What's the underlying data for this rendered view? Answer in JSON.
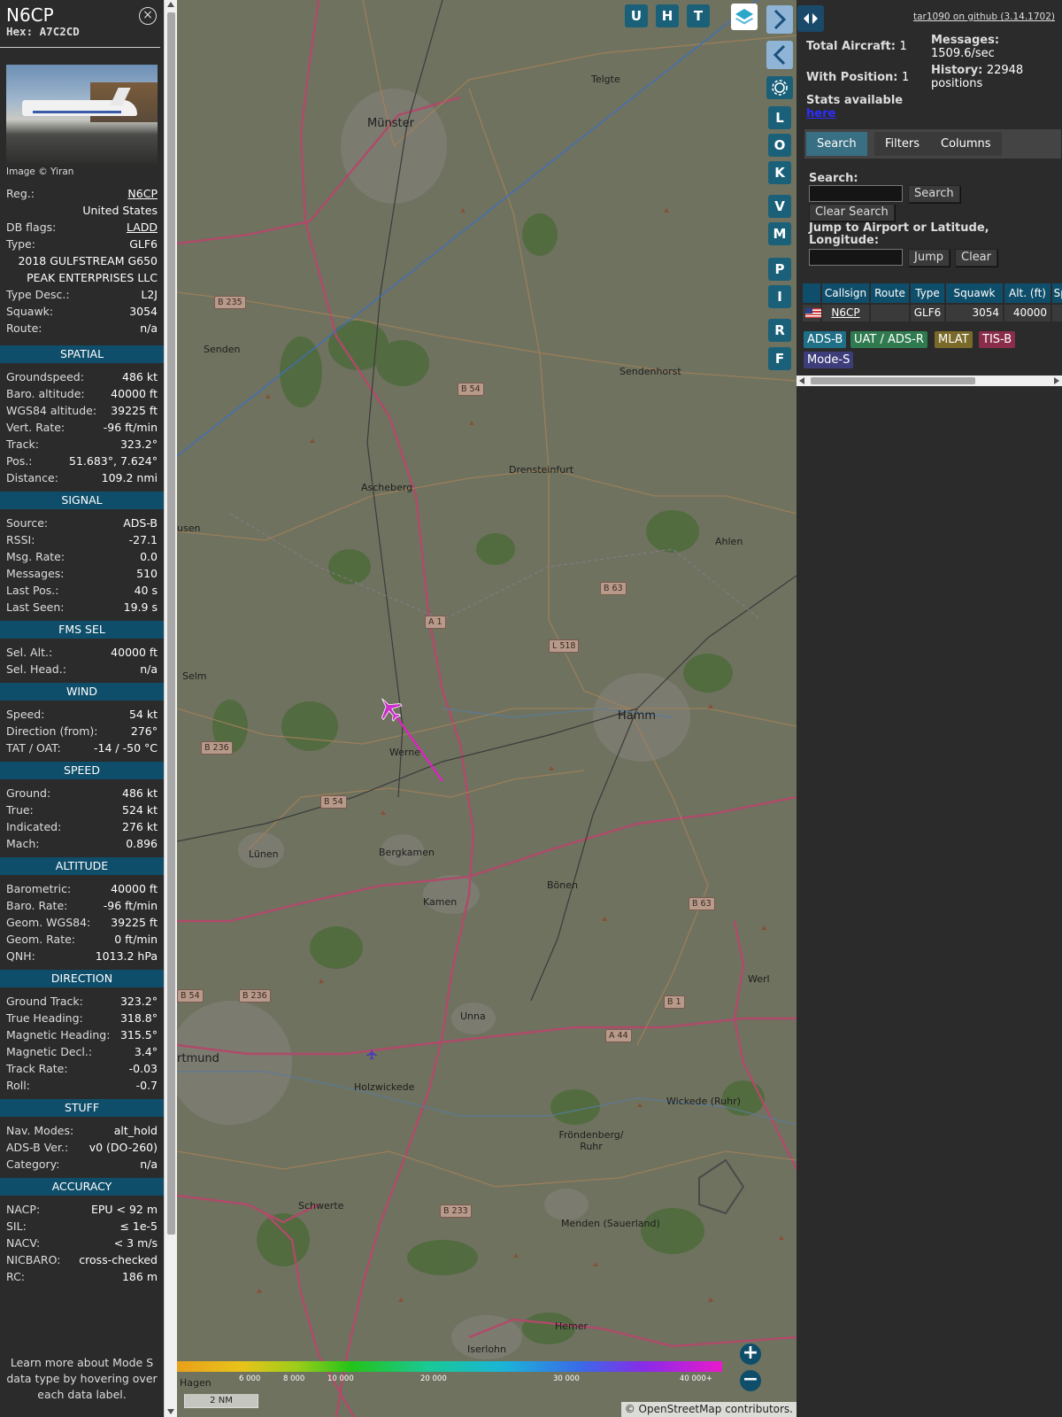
{
  "info": {
    "callsign": "N6CP",
    "hex_label": "Hex:",
    "hex": "A7C2CD",
    "close_icon": "close-circle-icon",
    "photo_credit": "Image © Yiran",
    "general": [
      {
        "label": "Reg.:",
        "value": "N6CP",
        "link": true
      },
      {
        "label": "",
        "value": "United States"
      },
      {
        "label": "DB flags:",
        "value": "LADD",
        "link": true
      },
      {
        "label": "Type:",
        "value": "GLF6"
      },
      {
        "label": "",
        "value": "2018 GULFSTREAM G650"
      },
      {
        "label": "",
        "value": "PEAK ENTERPRISES LLC"
      },
      {
        "label": "Type Desc.:",
        "value": "L2J"
      },
      {
        "label": "Squawk:",
        "value": "3054"
      },
      {
        "label": "Route:",
        "value": "n/a"
      }
    ],
    "sections": [
      {
        "title": "SPATIAL",
        "rows": [
          {
            "label": "Groundspeed:",
            "value": "486 kt"
          },
          {
            "label": "Baro. altitude:",
            "value": "40000 ft"
          },
          {
            "label": "WGS84 altitude:",
            "value": "39225 ft"
          },
          {
            "label": "Vert. Rate:",
            "value": "-96 ft/min"
          },
          {
            "label": "Track:",
            "value": "323.2°"
          },
          {
            "label": "Pos.:",
            "value": "51.683°, 7.624°"
          },
          {
            "label": "Distance:",
            "value": "109.2 nmi"
          }
        ]
      },
      {
        "title": "SIGNAL",
        "rows": [
          {
            "label": "Source:",
            "value": "ADS-B"
          },
          {
            "label": "RSSI:",
            "value": "-27.1"
          },
          {
            "label": "Msg. Rate:",
            "value": "0.0"
          },
          {
            "label": "Messages:",
            "value": "510"
          },
          {
            "label": "Last Pos.:",
            "value": "40 s"
          },
          {
            "label": "Last Seen:",
            "value": "19.9 s"
          }
        ]
      },
      {
        "title": "FMS SEL",
        "rows": [
          {
            "label": "Sel. Alt.:",
            "value": "40000 ft"
          },
          {
            "label": "Sel. Head.:",
            "value": "n/a"
          }
        ]
      },
      {
        "title": "WIND",
        "rows": [
          {
            "label": "Speed:",
            "value": "54 kt"
          },
          {
            "label": "Direction (from):",
            "value": "276°"
          },
          {
            "label": "TAT / OAT:",
            "value": "-14 / -50 °C"
          }
        ]
      },
      {
        "title": "SPEED",
        "rows": [
          {
            "label": "Ground:",
            "value": "486 kt"
          },
          {
            "label": "True:",
            "value": "524 kt"
          },
          {
            "label": "Indicated:",
            "value": "276 kt"
          },
          {
            "label": "Mach:",
            "value": "0.896"
          }
        ]
      },
      {
        "title": "ALTITUDE",
        "rows": [
          {
            "label": "Barometric:",
            "value": "40000 ft"
          },
          {
            "label": "Baro. Rate:",
            "value": "-96 ft/min"
          },
          {
            "label": "Geom. WGS84:",
            "value": "39225 ft"
          },
          {
            "label": "Geom. Rate:",
            "value": "0 ft/min"
          },
          {
            "label": "QNH:",
            "value": "1013.2 hPa"
          }
        ]
      },
      {
        "title": "DIRECTION",
        "rows": [
          {
            "label": "Ground Track:",
            "value": "323.2°"
          },
          {
            "label": "True Heading:",
            "value": "318.8°"
          },
          {
            "label": "Magnetic Heading:",
            "value": "315.5°"
          },
          {
            "label": "Magnetic Decl.:",
            "value": "3.4°"
          },
          {
            "label": "Track Rate:",
            "value": "-0.03"
          },
          {
            "label": "Roll:",
            "value": "-0.7"
          }
        ]
      },
      {
        "title": "STUFF",
        "rows": [
          {
            "label": "Nav. Modes:",
            "value": "alt_hold"
          },
          {
            "label": "ADS-B Ver.:",
            "value": "v0 (DO-260)"
          },
          {
            "label": "Category:",
            "value": "n/a"
          }
        ]
      },
      {
        "title": "ACCURACY",
        "rows": [
          {
            "label": "NACP:",
            "value": "EPU < 92 m"
          },
          {
            "label": "SIL:",
            "value": "≤ 1e-5"
          },
          {
            "label": "NACV:",
            "value": "< 3 m/s"
          },
          {
            "label": "NICBARO:",
            "value": "cross-checked"
          },
          {
            "label": "RC:",
            "value": "186 m"
          }
        ]
      }
    ],
    "footnote": "Learn more about Mode S data type by hovering over each data label."
  },
  "map": {
    "buttons_top": [
      "U",
      "H",
      "T"
    ],
    "layers_icon": "layers-icon",
    "side_buttons": [
      "L",
      "O",
      "K",
      "V",
      "M",
      "P",
      "I",
      "R",
      "F"
    ],
    "expand_icon": "chevron-right-icon",
    "collapse_icon": "chevron-left-icon",
    "toggle_icon": "arrows-left-right-icon",
    "settings_icon": "gear-icon",
    "zoom_in": "+",
    "zoom_out": "−",
    "towns": [
      {
        "name": "Münster",
        "big": true
      },
      {
        "name": "Telgte"
      },
      {
        "name": "Senden"
      },
      {
        "name": "Sendenhorst"
      },
      {
        "name": "Ascheberg"
      },
      {
        "name": "Drensteinfurt"
      },
      {
        "name": "Ahlen"
      },
      {
        "name": "Selm"
      },
      {
        "name": "Hamm",
        "big": true
      },
      {
        "name": "Werne"
      },
      {
        "name": "Lünen"
      },
      {
        "name": "Bergkamen"
      },
      {
        "name": "Bönen"
      },
      {
        "name": "Kamen"
      },
      {
        "name": "Werl"
      },
      {
        "name": "Unna"
      },
      {
        "name": "rtmund",
        "big": true
      },
      {
        "name": "Holzwickede"
      },
      {
        "name": "Wickede (Ruhr)"
      },
      {
        "name": "Fröndenberg/ Ruhr"
      },
      {
        "name": "Schwerte"
      },
      {
        "name": "Menden (Sauerland)"
      },
      {
        "name": "Hemer"
      },
      {
        "name": "Iserlohn"
      },
      {
        "name": "Hagen"
      },
      {
        "name": "usen"
      }
    ],
    "road_labels": [
      "B 235",
      "B 54",
      "A 1",
      "B 63",
      "L 518",
      "B 236",
      "B 54",
      "B 63",
      "B 54",
      "B 236",
      "B 1",
      "A 44",
      "B 233"
    ],
    "legend_ticks": [
      "6 000",
      "8 000",
      "10 000",
      "20 000",
      "30 000",
      "40 000+"
    ],
    "scale": "2 NM",
    "credit": "© OpenStreetMap contributors."
  },
  "sidebar": {
    "github": "tar1090 on github (3.14.1702)",
    "total_label": "Total Aircraft:",
    "total": "1",
    "position_label": "With Position:",
    "position": "1",
    "stats_text": "Stats available",
    "stats_link": "here",
    "messages_label": "Messages:",
    "messages": "1509.6/sec",
    "history_label": "History:",
    "history": "22948 positions",
    "tabs": [
      "Search",
      "Filters",
      "Columns"
    ],
    "search_label": "Search:",
    "search_value": "",
    "search_btn": "Search",
    "clear_search_btn": "Clear Search",
    "jump_label": "Jump to Airport or Latitude, Longitude:",
    "jump_value": "",
    "jump_btn": "Jump",
    "clear_btn": "Clear",
    "table": {
      "headers": [
        "Callsign",
        "Route",
        "Type",
        "Squawk",
        "Alt. (ft)",
        "Spd."
      ],
      "rows": [
        {
          "flag": "us-flag-icon",
          "callsign": "N6CP",
          "route": "",
          "type": "GLF6",
          "squawk": "3054",
          "alt": "40000",
          "spd": ""
        }
      ]
    },
    "source_tags": [
      {
        "label": "ADS-B",
        "color": "#1f6f86"
      },
      {
        "label": "UAT / ADS-R",
        "color": "#2f7a4f"
      },
      {
        "label": "MLAT",
        "color": "#7a6a2a"
      },
      {
        "label": "TIS-B",
        "color": "#8a2d4a"
      },
      {
        "label": "Mode-S",
        "color": "#3d3d7a"
      }
    ]
  },
  "colors": {
    "section_bg": "#0f4e6a",
    "button_bg": "#1a6079",
    "track": "#e81acb",
    "aircraft": "#c832c8"
  }
}
